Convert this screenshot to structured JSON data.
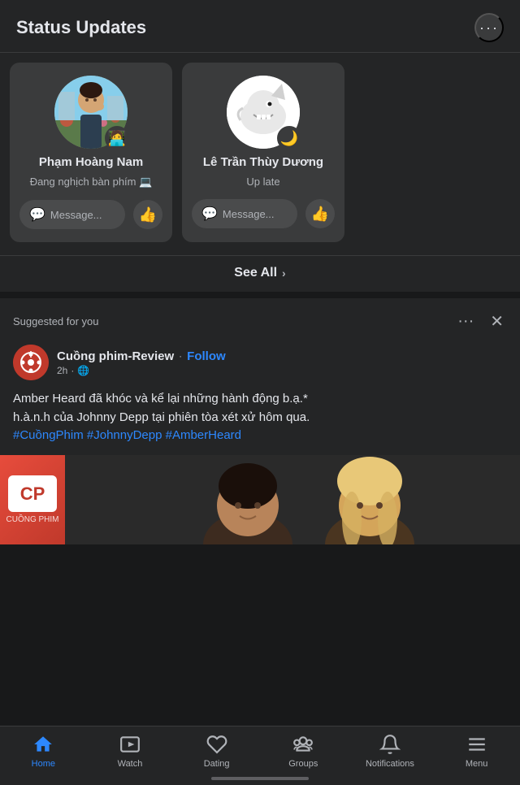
{
  "header": {
    "title": "Status Updates",
    "more_label": "···"
  },
  "status_cards": [
    {
      "id": "card1",
      "name": "Phạm Hoàng Nam",
      "status": "Đang nghịch bàn phím 💻",
      "status_emoji": "🧑‍💻",
      "avatar_type": "person",
      "message_placeholder": "Message..."
    },
    {
      "id": "card2",
      "name": "Lê Trần Thùy Dương",
      "status": "Up late",
      "status_emoji": "🌙",
      "avatar_type": "shark",
      "message_placeholder": "Message..."
    }
  ],
  "see_all": {
    "label": "See All",
    "chevron": "›"
  },
  "suggested_section": {
    "label": "Suggested for you",
    "more_label": "···",
    "close_label": "✕"
  },
  "suggested_post": {
    "page_name": "Cuồng phim-Review",
    "follow_label": "Follow",
    "dot": "·",
    "time": "2h",
    "globe": "🌐",
    "text": "Amber Heard đã khóc và kể lại những hành động b.ạ.*\nh.à.n.h của Johnny Depp tại phiên tòa xét xử hôm qua.",
    "hashtags": "#CuồngPhim #JohnnyDepp #AmberHeard"
  },
  "bottom_nav": {
    "items": [
      {
        "id": "home",
        "label": "Home",
        "active": true
      },
      {
        "id": "watch",
        "label": "Watch",
        "active": false
      },
      {
        "id": "dating",
        "label": "Dating",
        "active": false
      },
      {
        "id": "groups",
        "label": "Groups",
        "active": false
      },
      {
        "id": "notifications",
        "label": "Notifications",
        "active": false
      },
      {
        "id": "menu",
        "label": "Menu",
        "active": false
      }
    ]
  },
  "colors": {
    "active": "#2d88ff",
    "inactive": "#b0b3b8",
    "bg": "#18191a",
    "card_bg": "#3a3b3c",
    "surface": "#242526"
  }
}
